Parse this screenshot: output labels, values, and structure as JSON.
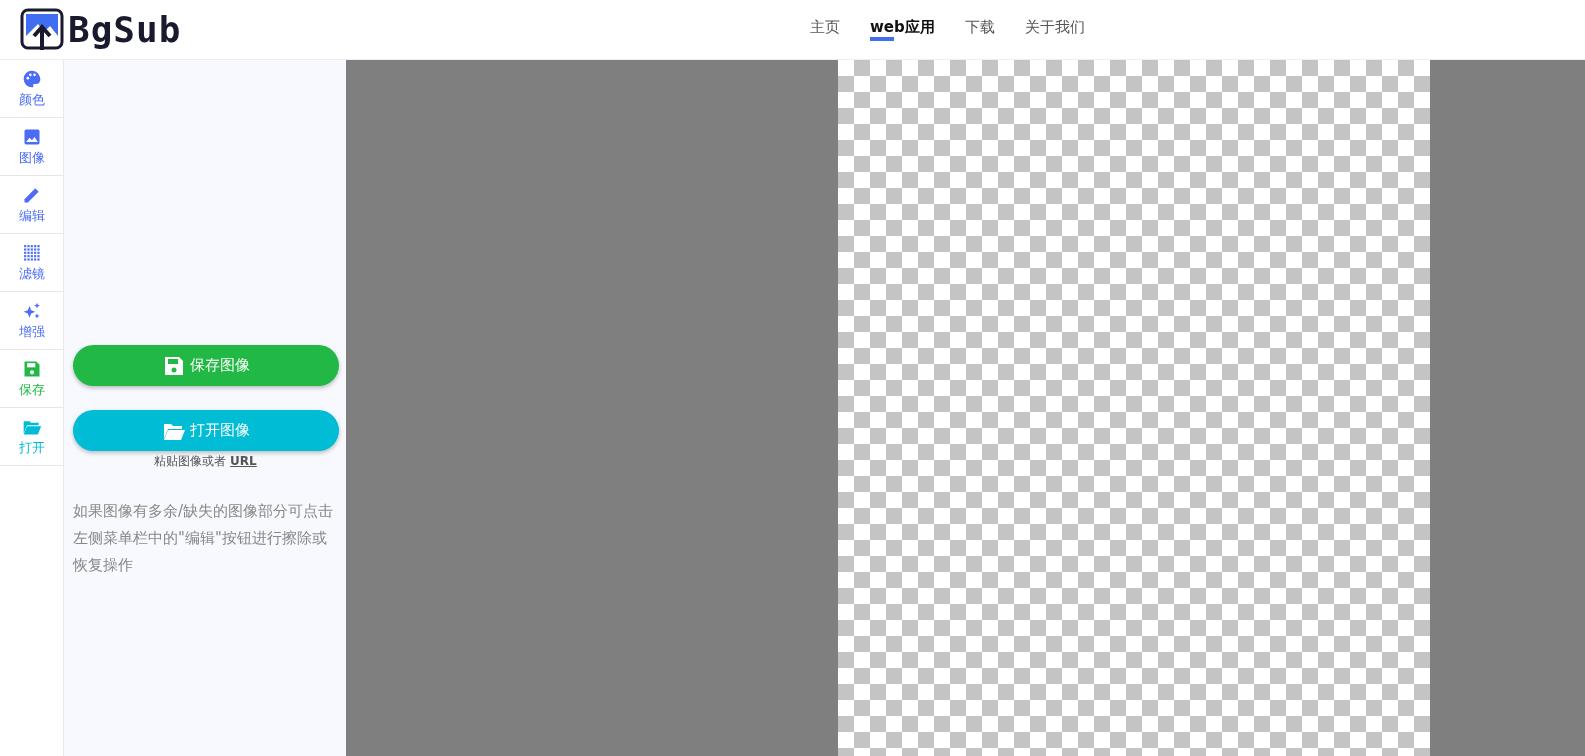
{
  "header": {
    "logo": "BgSub",
    "nav": [
      {
        "label": "主页",
        "selected": false
      },
      {
        "label": "web应用",
        "selected": true
      },
      {
        "label": "下载",
        "selected": false
      },
      {
        "label": "关于我们",
        "selected": false
      }
    ]
  },
  "sidebar": {
    "items": [
      {
        "label": "颜色",
        "kind": "palette",
        "color": "#4a6cf7"
      },
      {
        "label": "图像",
        "kind": "image",
        "color": "#4a6cf7"
      },
      {
        "label": "编辑",
        "kind": "pencil",
        "color": "#4a6cf7"
      },
      {
        "label": "滤镜",
        "kind": "dots",
        "color": "#4a6cf7"
      },
      {
        "label": "增强",
        "kind": "sparkle",
        "color": "#4a6cf7"
      },
      {
        "label": "保存",
        "kind": "floppy",
        "color": "#22b845"
      },
      {
        "label": "打开",
        "kind": "folder",
        "color": "#00bcd4"
      }
    ]
  },
  "panel": {
    "save_button": "保存图像",
    "open_button": "打开图像",
    "paste_text": "粘贴图像或者",
    "paste_link": "URL",
    "hint": "如果图像有多余/缺失的图像部分可点击左侧菜单栏中的\"编辑\"按钮进行擦除或恢复操作"
  }
}
